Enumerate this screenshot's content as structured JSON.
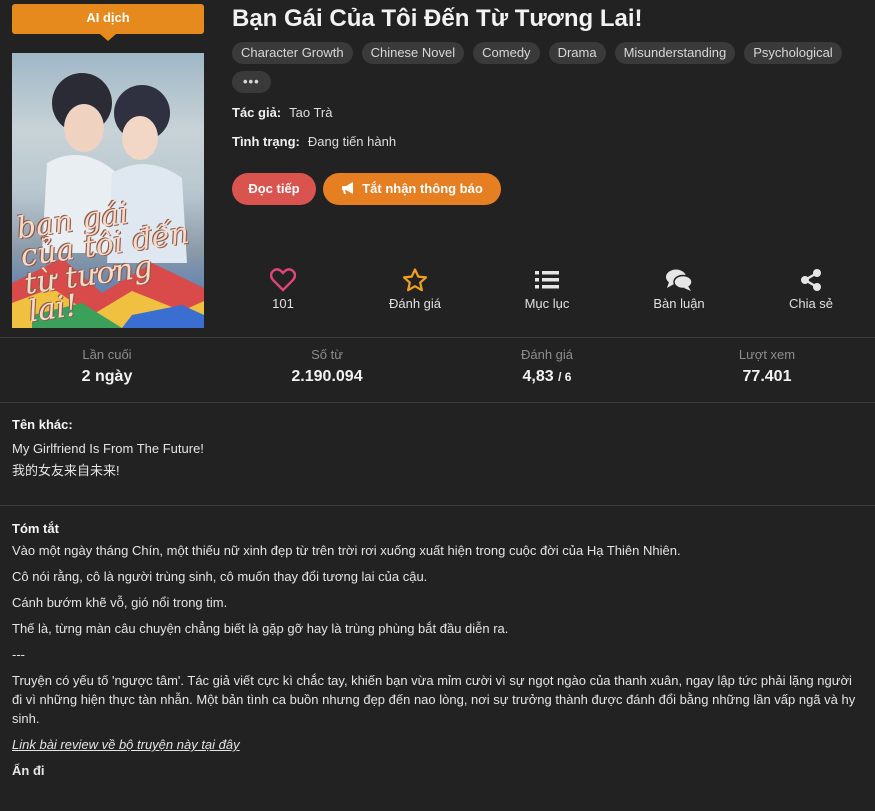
{
  "badge": {
    "label": "AI dịch"
  },
  "cover": {
    "title": "bạn gái của tôi đến từ tương lai!"
  },
  "novel": {
    "title": "Bạn Gái Của Tôi Đến Từ Tương Lai!",
    "tags": [
      "Character Growth",
      "Chinese Novel",
      "Comedy",
      "Drama",
      "Misunderstanding",
      "Psychological"
    ],
    "more_tags": "•••",
    "author_label": "Tác giả:",
    "author": "Tao Trà",
    "status_label": "Tình trạng:",
    "status": "Đang tiến hành"
  },
  "buttons": {
    "read": "Đọc tiếp",
    "notify": "Tắt nhận thông báo"
  },
  "actions": {
    "like_count": "101",
    "rate": "Đánh giá",
    "toc": "Mục lục",
    "comment": "Bàn luận",
    "share": "Chia sẻ"
  },
  "stats": {
    "last_label": "Lần cuối",
    "last_value": "2 ngày",
    "words_label": "Số từ",
    "words_value": "2.190.094",
    "rating_label": "Đánh giá",
    "rating_value": "4,83",
    "rating_max": "/ 6",
    "views_label": "Lượt xem",
    "views_value": "77.401"
  },
  "other_names": {
    "heading": "Tên khác:",
    "names": [
      "My Girlfriend Is From The Future!",
      "我的女友来自未来!"
    ]
  },
  "summary": {
    "heading": "Tóm tắt",
    "paragraphs": [
      "Vào một ngày tháng Chín, một thiếu nữ xinh đẹp từ trên trời rơi xuống xuất hiện trong cuộc đời của Hạ Thiên Nhiên.",
      "Cô nói rằng, cô là người trùng sinh, cô muốn thay đổi tương lai của cậu.",
      "Cánh bướm khẽ vỗ, gió nổi trong tim.",
      "Thế là, từng màn câu chuyện chẳng biết là gặp gỡ hay là trùng phùng bắt đầu diễn ra.",
      "---",
      "Truyện có yếu tố 'ngược tâm'. Tác giả viết cực kì chắc tay, khiến bạn vừa mỉm cười vì sự ngọt ngào của thanh xuân, ngay lập tức phải lặng người đi vì những hiện thực tàn nhẫn. Một bản tình ca buồn nhưng đẹp đến nao lòng, nơi sự trưởng thành được đánh đổi bằng những lần vấp ngã và hy sinh."
    ],
    "review_link": "Link bài review về bộ truyện này tại đây",
    "hide": "Ẩn đi"
  },
  "colors": {
    "background": "#222222",
    "accent_orange": "#e67e22",
    "accent_red": "#d9534f",
    "heart": "#e0457b",
    "star": "#f0a020"
  }
}
